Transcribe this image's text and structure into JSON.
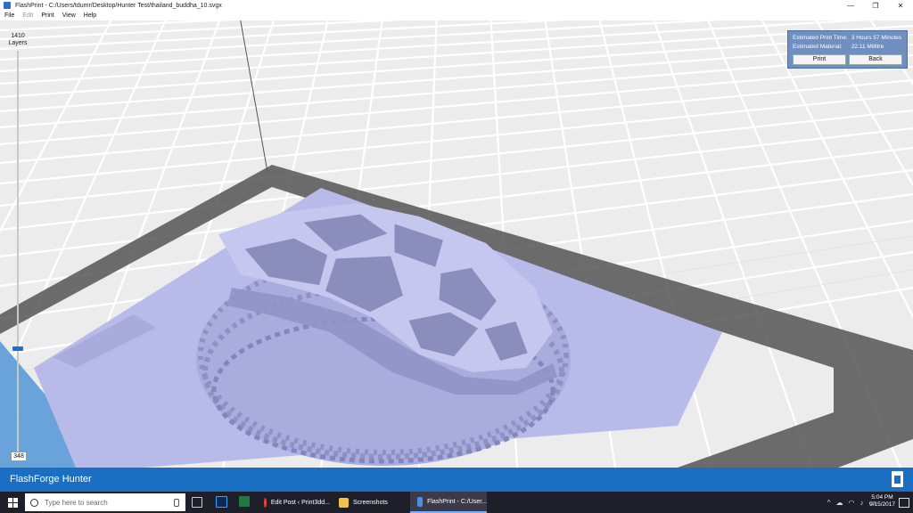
{
  "window": {
    "title": "FlashPrint - C:/Users/tdumr/Desktop/Hunter Test/thailand_buddha_10.svgx",
    "minimize": "—",
    "maximize": "❐",
    "close": "✕"
  },
  "menu": {
    "file": "File",
    "edit": "Edit",
    "print": "Print",
    "view": "View",
    "help": "Help"
  },
  "layers": {
    "top_value": "1410",
    "top_label": "Layers",
    "bottom_value": "348"
  },
  "estimate": {
    "time_label": "Estimated Print Time:",
    "time_value": "3 Hours 57 Minutes",
    "material_label": "Estimated Material:",
    "material_value": "22.11 Millitre",
    "print_button": "Print",
    "back_button": "Back"
  },
  "footer": {
    "machine_name": "FlashForge Hunter"
  },
  "taskbar": {
    "search_placeholder": "Type here to search",
    "apps": [
      {
        "label": "Edit Post ‹ Print3dd..."
      },
      {
        "label": "Screenshots"
      },
      {
        "label": "FlashPrint - C:/User..."
      }
    ],
    "time": "5:04 PM",
    "date": "9/15/2017"
  },
  "colors": {
    "accent": "#1a6fc2",
    "model": "#b5b8e6",
    "panel": "#6f8fbe"
  }
}
